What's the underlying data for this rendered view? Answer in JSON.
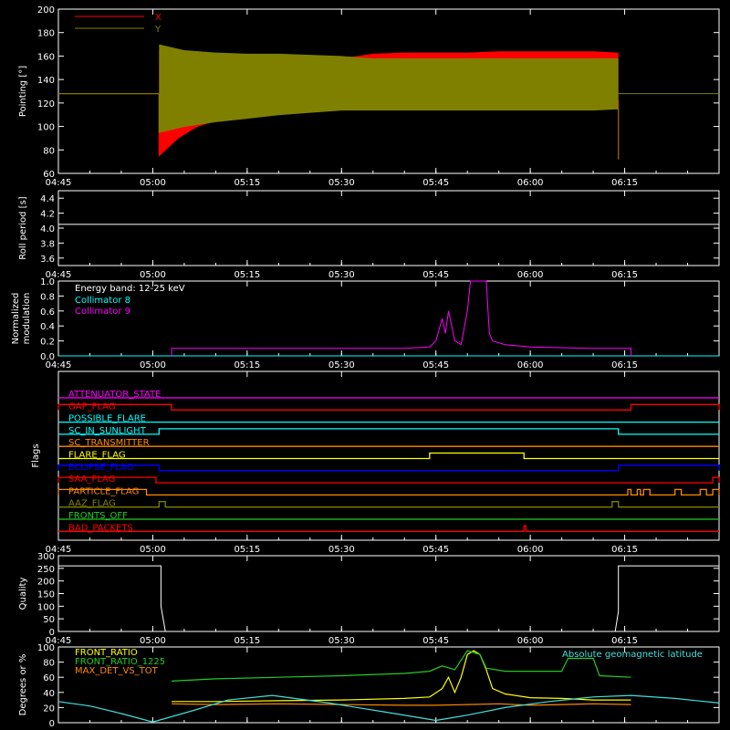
{
  "colors": {
    "background": "#000000",
    "axis": "#ffffff",
    "red": "#ff0000",
    "olive": "#808000",
    "cyan": "#00ffff",
    "magenta": "#ff00ff",
    "yellow": "#ffff00",
    "green": "#22cc22",
    "orange": "#ff8800",
    "blue": "#0000ff",
    "white": "#ffffff",
    "lightcyan": "#40e0e0"
  },
  "time_axis": {
    "ticks": [
      "04:45",
      "05:00",
      "05:15",
      "05:30",
      "05:45",
      "06:00",
      "06:15"
    ],
    "tick_minutes": [
      285,
      300,
      315,
      330,
      345,
      360,
      375
    ],
    "range_minutes": [
      285,
      390
    ]
  },
  "chart_data": [
    {
      "type": "line",
      "ylabel": "Pointing [°]",
      "ylim": [
        60,
        200
      ],
      "yticks": [
        60,
        80,
        100,
        120,
        140,
        160,
        180,
        200
      ],
      "legend": [
        {
          "name": "X",
          "color": "#ff0000"
        },
        {
          "name": "Y",
          "color": "#808000"
        }
      ],
      "series": [
        {
          "name": "X",
          "color": "#ff0000",
          "points": [
            [
              285,
              128
            ],
            [
              301,
              128
            ],
            [
              301,
              75
            ],
            [
              304,
              90
            ],
            [
              307,
              100
            ],
            [
              310,
              105
            ],
            [
              315,
              111
            ],
            [
              320,
              115
            ],
            [
              325,
              118
            ],
            [
              330,
              120
            ],
            [
              335,
              122
            ],
            [
              340,
              123
            ],
            [
              345,
              123
            ],
            [
              350,
              124
            ],
            [
              355,
              124
            ],
            [
              360,
              124
            ],
            [
              365,
              124
            ],
            [
              370,
              124
            ],
            [
              374,
              122
            ],
            [
              374,
              72
            ]
          ],
          "upper": [
            [
              301,
              165
            ],
            [
              304,
              160
            ],
            [
              307,
              157
            ],
            [
              310,
              156
            ],
            [
              315,
              155
            ],
            [
              320,
              155
            ],
            [
              325,
              156
            ],
            [
              330,
              158
            ],
            [
              335,
              162
            ],
            [
              340,
              163
            ],
            [
              345,
              163
            ],
            [
              350,
              163
            ],
            [
              355,
              164
            ],
            [
              360,
              164
            ],
            [
              365,
              164
            ],
            [
              370,
              164
            ],
            [
              374,
              163
            ],
            [
              374,
              198
            ]
          ]
        },
        {
          "name": "Y",
          "color": "#808000",
          "points": [
            [
              285,
              128
            ],
            [
              301,
              128
            ],
            [
              301,
              95
            ],
            [
              305,
              100
            ],
            [
              310,
              104
            ],
            [
              315,
              107
            ],
            [
              320,
              110
            ],
            [
              325,
              112
            ],
            [
              330,
              114
            ],
            [
              335,
              114
            ],
            [
              340,
              114
            ],
            [
              345,
              114
            ],
            [
              350,
              114
            ],
            [
              355,
              114
            ],
            [
              360,
              114
            ],
            [
              365,
              114
            ],
            [
              370,
              114
            ],
            [
              374,
              115
            ],
            [
              374,
              72
            ]
          ],
          "upper": [
            [
              301,
              170
            ],
            [
              305,
              165
            ],
            [
              310,
              163
            ],
            [
              315,
              162
            ],
            [
              320,
              162
            ],
            [
              325,
              161
            ],
            [
              330,
              160
            ],
            [
              335,
              158
            ],
            [
              340,
              158
            ],
            [
              345,
              158
            ],
            [
              350,
              158
            ],
            [
              355,
              158
            ],
            [
              360,
              158
            ],
            [
              365,
              158
            ],
            [
              370,
              158
            ],
            [
              374,
              158
            ],
            [
              374,
              180
            ]
          ]
        }
      ]
    },
    {
      "type": "line",
      "ylabel": "Roll period [s]",
      "ylim": [
        3.5,
        4.5
      ],
      "yticks": [
        3.6,
        3.8,
        4.0,
        4.2,
        4.4
      ],
      "series": [
        {
          "name": "roll",
          "color": "#ffffff",
          "points": [
            [
              285,
              4.05
            ],
            [
              390,
              4.05
            ]
          ]
        }
      ]
    },
    {
      "type": "line",
      "ylabel": "Normalized modulation",
      "ylim": [
        0,
        1
      ],
      "yticks": [
        0.0,
        0.2,
        0.4,
        0.6,
        0.8,
        1.0
      ],
      "annotations": [
        "Energy band: 12-25 keV"
      ],
      "legend": [
        {
          "name": "Collimator 8",
          "color": "#00ffff"
        },
        {
          "name": "Collimator 9",
          "color": "#ff00ff"
        }
      ],
      "series": [
        {
          "name": "Collimator 8",
          "color": "#00ffff",
          "points": [
            [
              285,
              0.0
            ],
            [
              390,
              0.0
            ]
          ]
        },
        {
          "name": "Collimator 9",
          "color": "#ff00ff",
          "points": [
            [
              303,
              0.0
            ],
            [
              303,
              0.1
            ],
            [
              310,
              0.1
            ],
            [
              320,
              0.1
            ],
            [
              330,
              0.1
            ],
            [
              340,
              0.1
            ],
            [
              344,
              0.12
            ],
            [
              345,
              0.2
            ],
            [
              346,
              0.5
            ],
            [
              346.5,
              0.3
            ],
            [
              347,
              0.6
            ],
            [
              347.5,
              0.4
            ],
            [
              348,
              0.2
            ],
            [
              349,
              0.15
            ],
            [
              350,
              0.6
            ],
            [
              350.5,
              1.0
            ],
            [
              353,
              1.0
            ],
            [
              353.5,
              0.3
            ],
            [
              354,
              0.2
            ],
            [
              356,
              0.15
            ],
            [
              360,
              0.12
            ],
            [
              365,
              0.11
            ],
            [
              370,
              0.1
            ],
            [
              376,
              0.1
            ],
            [
              376,
              0.0
            ]
          ]
        }
      ]
    },
    {
      "type": "step",
      "ylabel": "Flags",
      "flags": [
        {
          "name": "ATTENUATOR_STATE",
          "color": "#ff00ff",
          "on": []
        },
        {
          "name": "GAP_FLAG",
          "color": "#ff0000",
          "on": [
            [
              285,
              303
            ],
            [
              376,
              390
            ]
          ]
        },
        {
          "name": "POSSIBLE_FLARE",
          "color": "#00ffff",
          "on": []
        },
        {
          "name": "SC_IN_SUNLIGHT",
          "color": "#00ffff",
          "on": [
            [
              301,
              374
            ]
          ]
        },
        {
          "name": "SC_TRANSMITTER",
          "color": "#ff8800",
          "on": []
        },
        {
          "name": "FLARE_FLAG",
          "color": "#ffff00",
          "on": [
            [
              344,
              359
            ]
          ]
        },
        {
          "name": "ECLIPSE_FLAG",
          "color": "#0000ff",
          "on": [
            [
              285,
              301
            ],
            [
              374,
              390
            ]
          ]
        },
        {
          "name": "SAA_FLAG",
          "color": "#ff0000",
          "on": [
            [
              285,
              300.5
            ],
            [
              389,
              390
            ]
          ]
        },
        {
          "name": "PARTICLE_FLAG",
          "color": "#ff8800",
          "on": [
            [
              285,
              299
            ],
            [
              375.5,
              376
            ],
            [
              377,
              377.5
            ],
            [
              378,
              379
            ],
            [
              383,
              384
            ],
            [
              387,
              388
            ],
            [
              389,
              390
            ]
          ]
        },
        {
          "name": "AAZ_FLAG",
          "color": "#808000",
          "on": [
            [
              301,
              302
            ],
            [
              373,
              374
            ]
          ]
        },
        {
          "name": "FRONTS_OFF",
          "color": "#22cc22",
          "on": []
        },
        {
          "name": "BAD_PACKETS",
          "color": "#ff0000",
          "on": [
            [
              359,
              359.3
            ]
          ]
        }
      ]
    },
    {
      "type": "line",
      "ylabel": "Quality",
      "ylim": [
        0,
        300
      ],
      "yticks": [
        0,
        50,
        100,
        150,
        200,
        250,
        300
      ],
      "series": [
        {
          "name": "quality",
          "color": "#ffffff",
          "points": [
            [
              285,
              260
            ],
            [
              301.3,
              260
            ],
            [
              301.3,
              100
            ],
            [
              302,
              0
            ],
            [
              373.5,
              0
            ],
            [
              374,
              80
            ],
            [
              374,
              260
            ],
            [
              390,
              260
            ]
          ]
        }
      ]
    },
    {
      "type": "line",
      "ylabel": "Degrees or %",
      "ylim": [
        0,
        100
      ],
      "yticks": [
        0,
        20,
        40,
        60,
        80,
        100
      ],
      "legend": [
        {
          "name": "FRONT_RATIO",
          "color": "#ffff00"
        },
        {
          "name": "FRONT_RATIO_1225",
          "color": "#22cc22"
        },
        {
          "name": "MAX_DET_VS_TOT",
          "color": "#ff8800"
        }
      ],
      "annotations": [
        "Absolute geomagnetic latitude"
      ],
      "series": [
        {
          "name": "FRONT_RATIO",
          "color": "#ffff00",
          "points": [
            [
              303,
              28
            ],
            [
              310,
              28
            ],
            [
              320,
              29
            ],
            [
              330,
              30
            ],
            [
              340,
              32
            ],
            [
              344,
              34
            ],
            [
              346,
              45
            ],
            [
              347,
              60
            ],
            [
              348,
              40
            ],
            [
              349,
              60
            ],
            [
              350,
              90
            ],
            [
              351,
              95
            ],
            [
              352,
              90
            ],
            [
              353,
              70
            ],
            [
              354,
              45
            ],
            [
              356,
              38
            ],
            [
              360,
              33
            ],
            [
              365,
              32
            ],
            [
              370,
              30
            ],
            [
              376,
              30
            ]
          ]
        },
        {
          "name": "FRONT_RATIO_1225",
          "color": "#22cc22",
          "points": [
            [
              303,
              55
            ],
            [
              310,
              58
            ],
            [
              320,
              60
            ],
            [
              330,
              62
            ],
            [
              340,
              65
            ],
            [
              344,
              68
            ],
            [
              346,
              75
            ],
            [
              348,
              70
            ],
            [
              350,
              95
            ],
            [
              352,
              90
            ],
            [
              353,
              72
            ],
            [
              356,
              68
            ],
            [
              360,
              68
            ],
            [
              365,
              68
            ],
            [
              366,
              85
            ],
            [
              370,
              85
            ],
            [
              371,
              62
            ],
            [
              376,
              60
            ]
          ]
        },
        {
          "name": "MAX_DET_VS_TOT",
          "color": "#ff8800",
          "points": [
            [
              303,
              25
            ],
            [
              310,
              24
            ],
            [
              320,
              25
            ],
            [
              330,
              24
            ],
            [
              340,
              23
            ],
            [
              345,
              23
            ],
            [
              350,
              24
            ],
            [
              355,
              25
            ],
            [
              360,
              23
            ],
            [
              365,
              24
            ],
            [
              370,
              25
            ],
            [
              376,
              24
            ]
          ]
        },
        {
          "name": "Absolute geomagnetic latitude",
          "color": "#40e0e0",
          "points": [
            [
              285,
              28
            ],
            [
              290,
              22
            ],
            [
              295,
              12
            ],
            [
              300,
              1
            ],
            [
              306,
              15
            ],
            [
              312,
              30
            ],
            [
              319,
              36
            ],
            [
              328,
              26
            ],
            [
              337,
              14
            ],
            [
              345,
              3
            ],
            [
              350,
              10
            ],
            [
              356,
              20
            ],
            [
              363,
              28
            ],
            [
              370,
              34
            ],
            [
              376,
              36
            ],
            [
              383,
              32
            ],
            [
              390,
              26
            ]
          ]
        }
      ]
    }
  ]
}
